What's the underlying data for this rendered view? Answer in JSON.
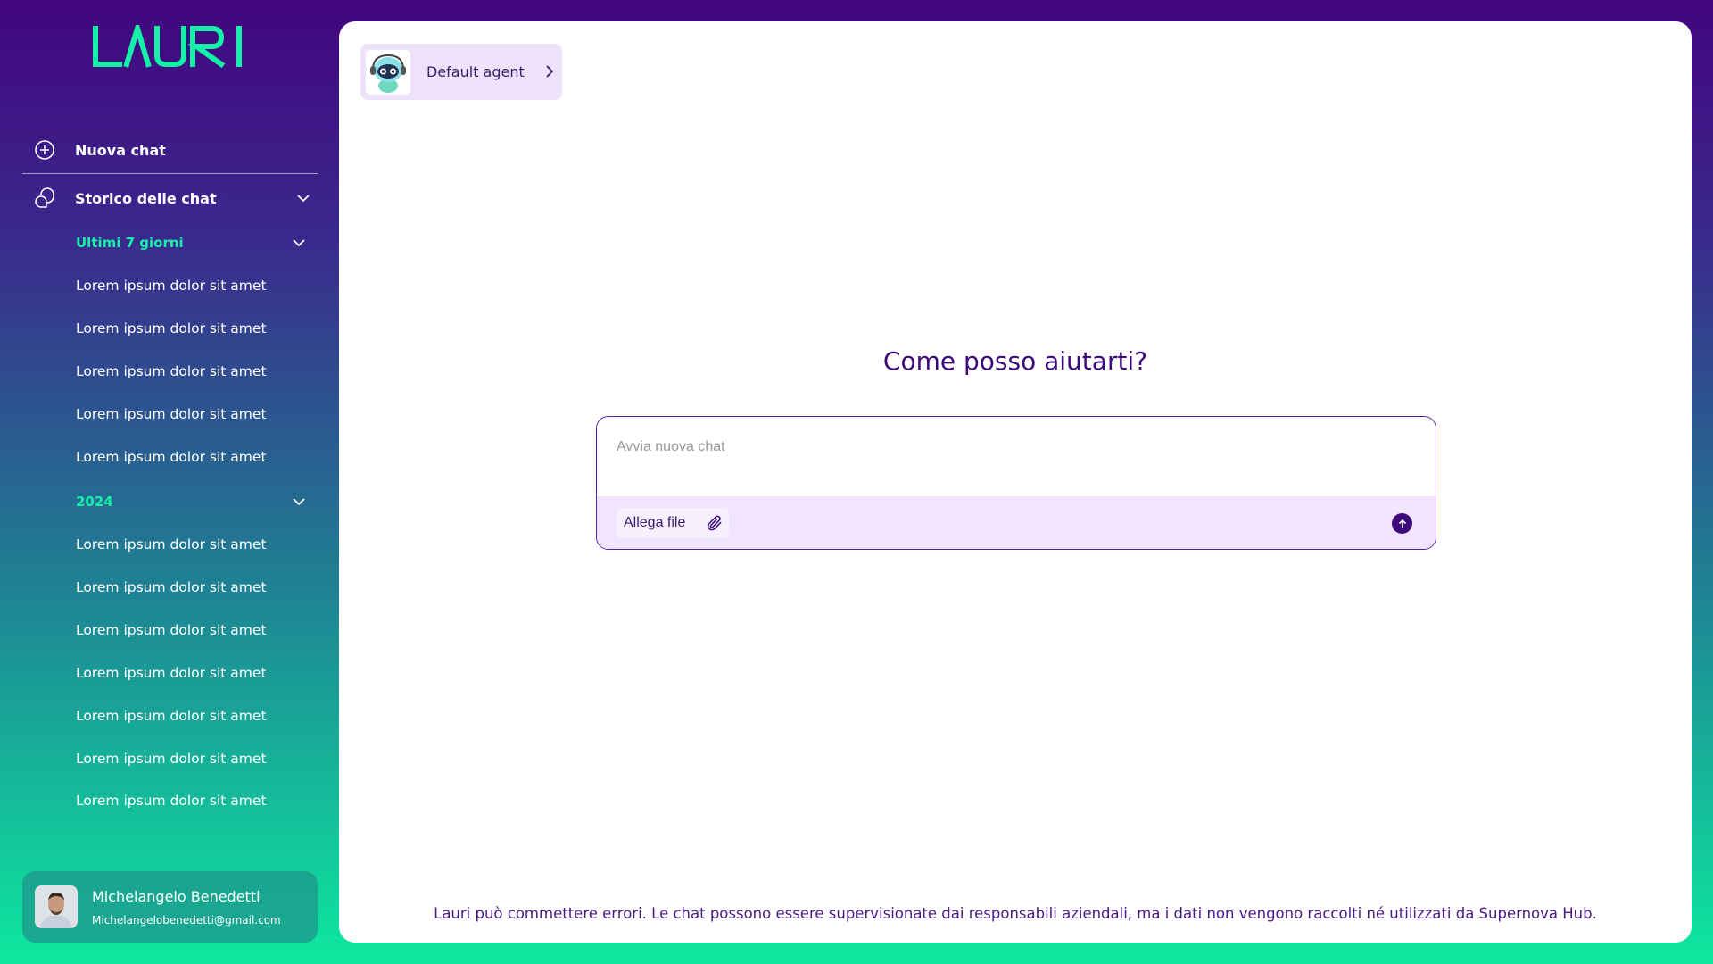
{
  "app": {
    "logo_text": "LAURI",
    "brand_color": "#13f0a8",
    "primary_color": "#3d0a7a"
  },
  "sidebar": {
    "new_chat": {
      "label": "Nuova chat",
      "icon": "plus-circle-icon"
    },
    "history": {
      "label": "Storico delle chat",
      "icon": "chat-bubbles-icon"
    },
    "groups": [
      {
        "title": "Ultimi 7 giorni",
        "items": [
          "Lorem ipsum dolor sit amet",
          "Lorem ipsum dolor sit amet",
          "Lorem ipsum dolor sit amet",
          "Lorem ipsum dolor sit amet",
          "Lorem ipsum dolor sit amet"
        ]
      },
      {
        "title": "2024",
        "items": [
          "Lorem ipsum dolor sit amet",
          "Lorem ipsum dolor sit amet",
          "Lorem ipsum dolor sit amet",
          "Lorem ipsum dolor sit amet",
          "Lorem ipsum dolor sit amet",
          "Lorem ipsum dolor sit amet",
          "Lorem ipsum dolor sit amet"
        ]
      }
    ],
    "user": {
      "name": "Michelangelo Benedetti",
      "email": "Michelangelobenedetti@gmail.com"
    }
  },
  "main": {
    "agent": {
      "label": "Default agent",
      "icon": "robot-agent-icon"
    },
    "headline": "Come posso aiutarti?",
    "chat": {
      "placeholder": "Avvia nuova chat",
      "attach_label": "Allega file",
      "attach_icon": "paperclip-icon",
      "send_icon": "arrow-up-icon"
    },
    "disclaimer": "Lauri può commettere errori. Le chat possono essere supervisionate dai responsabili aziendali, ma i dati non vengono raccolti né utilizzati da Supernova Hub."
  }
}
